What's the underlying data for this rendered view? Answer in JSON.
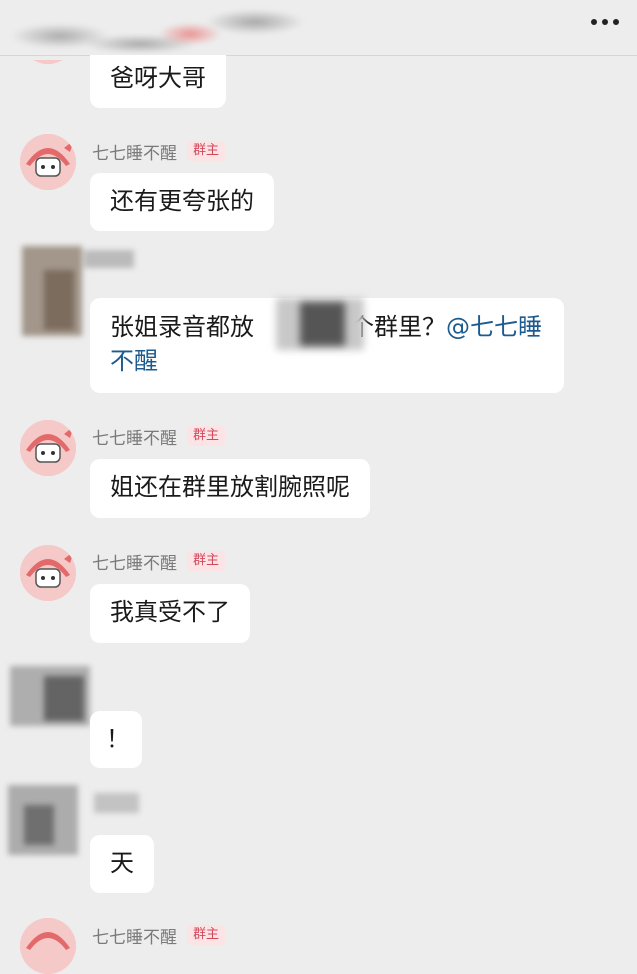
{
  "header": {
    "more_icon": "more-dots-icon"
  },
  "messages": [
    {
      "text": "爸呀大哥"
    },
    {
      "sender": "七七睡不醒",
      "badge": "群主",
      "text": "还有更夸张的"
    },
    {
      "text_a": "张姐录音都放",
      "text_b": "个群里？",
      "mention": "@七七睡不醒"
    },
    {
      "sender": "七七睡不醒",
      "badge": "群主",
      "text": "姐还在群里放割腕照呢"
    },
    {
      "sender": "七七睡不醒",
      "badge": "群主",
      "text": "我真受不了"
    },
    {
      "text": "！"
    },
    {
      "text": "天"
    },
    {
      "sender": "七七睡不醒",
      "badge": "群主"
    }
  ],
  "colors": {
    "background": "#ededed",
    "bubble": "#ffffff",
    "mention": "#1d5b8f",
    "badge_text": "#d24a5a",
    "badge_bg": "#fbe3e6"
  }
}
